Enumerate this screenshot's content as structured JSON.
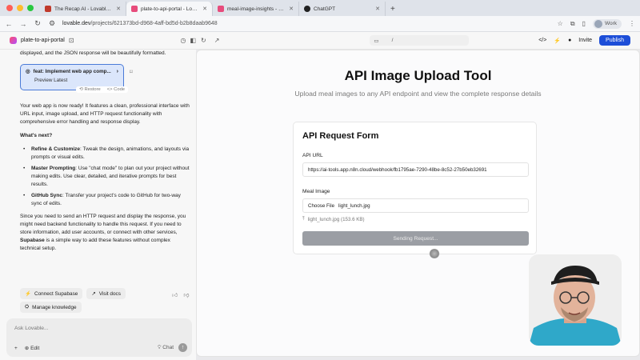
{
  "browser": {
    "tabs": [
      {
        "title": "The Recap AI - Lovable Cl...",
        "color": "#c0392b",
        "active": false
      },
      {
        "title": "plate-to-api-portal - Lovable",
        "color": "#e74c7c",
        "active": true
      },
      {
        "title": "meal-image-insights - Lovab...",
        "color": "#e74c7c",
        "active": false
      },
      {
        "title": "ChatGPT",
        "color": "#222222",
        "active": false
      }
    ],
    "new_tab": "+",
    "url_host": "lovable.dev",
    "url_path": "/projects/621373bd-d968-4aff-bd5d-b2b8daab9648",
    "profile": "Work"
  },
  "app_header": {
    "project_name": "plate-to-api-portal",
    "path": "/",
    "invite": "Invite",
    "publish": "Publish"
  },
  "chat": {
    "intro": "displayed, and the JSON response will be beautifully formatted.",
    "commit_title": "feat: Implement web app comp...",
    "commit_sub": "Preview Latest",
    "restore": "Restore",
    "code": "Code",
    "ready": "Your web app is now ready! It features a clean, professional interface with URL input, image upload, and HTTP request functionality with comprehensive error handling and response display.",
    "whats_next": "What's next?",
    "bullets": [
      {
        "bold": "Refine & Customize",
        "text": ": Tweak the design, animations, and layouts via prompts or visual edits."
      },
      {
        "bold": "Master Prompting",
        "text": ": Use \"chat mode\" to plan out your project without making edits. Use clear, detailed, and iterative prompts for best results."
      },
      {
        "bold": "GitHub Sync",
        "text": ": Transfer your project's code to GitHub for two-way sync of edits."
      }
    ],
    "backend_pre": "Since you need to send an HTTP request and display the response, you might need backend functionality to handle this request. If you need to store information, add user accounts, or connect with other services, ",
    "backend_bold": "Supabase",
    "backend_post": " is a simple way to add these features without complex technical setup.",
    "connect_supabase": "Connect Supabase",
    "visit_docs": "Visit docs",
    "manage_knowledge": "Manage knowledge",
    "composer_placeholder": "Ask Lovable...",
    "edit": "Edit",
    "chat_mode": "Chat"
  },
  "preview": {
    "title": "API Image Upload Tool",
    "subtitle": "Upload meal images to any API endpoint and view the complete response details",
    "form_title": "API Request Form",
    "api_url_label": "API URL",
    "api_url_value": "https://ai-tools.app.n8n.cloud/webhook/fb1795ae-7290-48be-8c52-27b50eb32691",
    "image_label": "Meal Image",
    "choose_file": "Choose File",
    "file_name": "light_lunch.jpg",
    "file_info": "light_lunch.jpg (153.6 KB)",
    "send_button": "Sending Request..."
  }
}
